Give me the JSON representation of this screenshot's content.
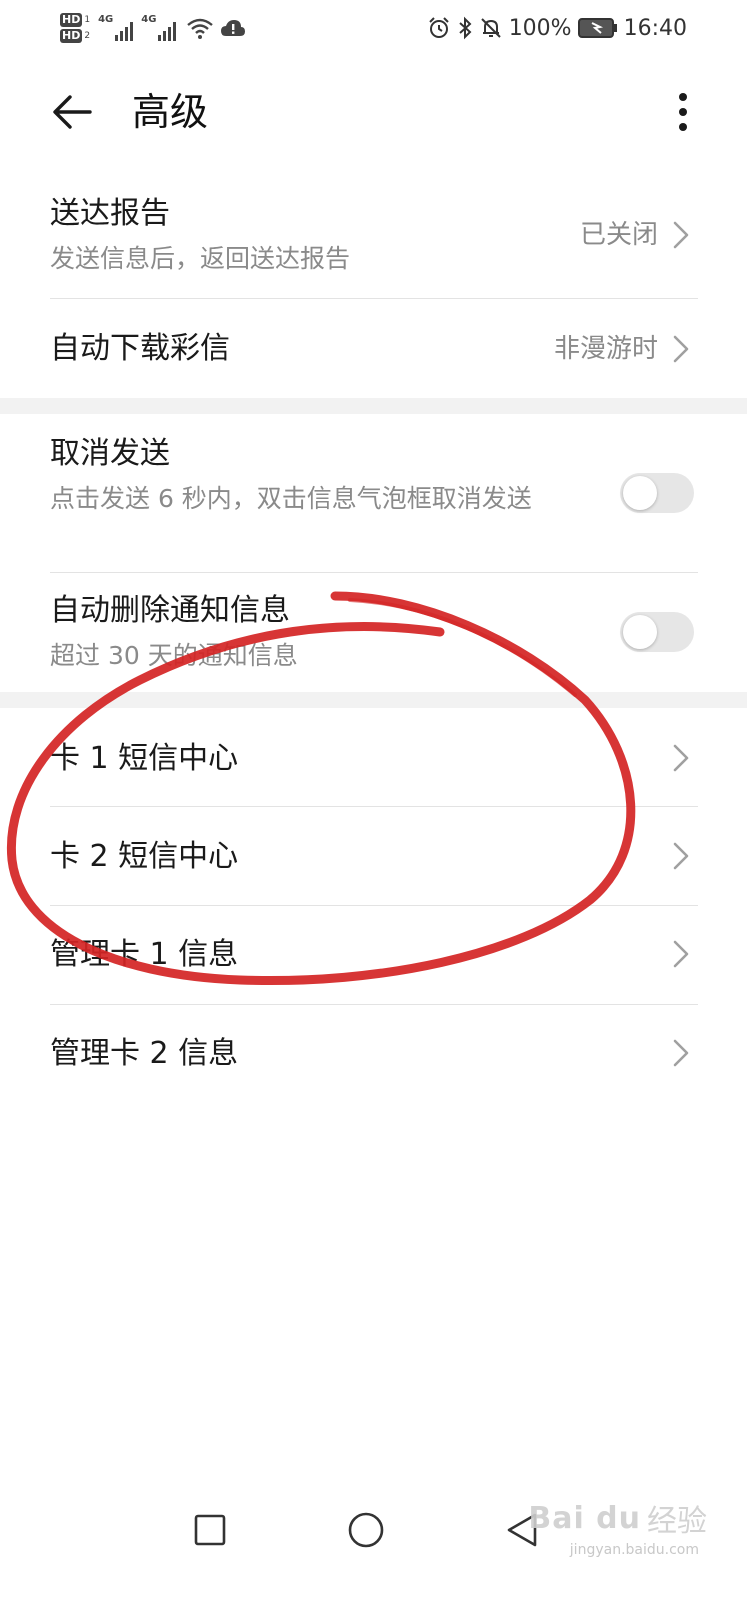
{
  "status_bar": {
    "left_icons": [
      "hd-1-icon",
      "hd-2-icon",
      "signal-4g-icon",
      "signal-4g-icon",
      "wifi-icon",
      "cloud-alert-icon"
    ],
    "network_label_1": "4G",
    "network_label_2": "4G",
    "hd_label": "HD",
    "sim_1": "1",
    "sim_2": "2",
    "right_icons": [
      "alarm-icon",
      "bluetooth-icon",
      "mute-icon",
      "battery-charging-icon"
    ],
    "battery": "100%",
    "time": "16:40"
  },
  "header": {
    "title": "高级",
    "back_icon": "arrow-left-icon",
    "menu_icon": "more-vertical-icon"
  },
  "group1": {
    "rows": [
      {
        "title": "送达报告",
        "subtitle": "发送信息后，返回送达报告",
        "value": "已关闭"
      },
      {
        "title": "自动下载彩信",
        "value": "非漫游时"
      }
    ]
  },
  "group2": {
    "rows": [
      {
        "title": "取消发送",
        "subtitle": "点击发送 6 秒内，双击信息气泡框取消发送",
        "switch_on": false
      },
      {
        "title": "自动删除通知信息",
        "subtitle": "超过 30 天的通知信息",
        "switch_on": false
      }
    ]
  },
  "group3": {
    "rows": [
      {
        "title": "卡 1 短信中心"
      },
      {
        "title": "卡 2 短信中心"
      },
      {
        "title": "管理卡 1 信息"
      },
      {
        "title": "管理卡 2 信息"
      }
    ]
  },
  "annotation": {
    "color": "#d42424"
  },
  "nav_bar": {
    "icons": [
      "recents-square-icon",
      "home-circle-icon",
      "back-triangle-icon"
    ]
  },
  "watermark": {
    "logo": "Bai du",
    "name": "经验",
    "url": "jingyan.baidu.com"
  },
  "colors": {
    "text_primary": "#1a1a1a",
    "text_secondary": "#8a8a8a",
    "divider": "#e3e3e3",
    "group_gap": "#f2f2f2",
    "toggle_off": "#e6e6e6"
  }
}
